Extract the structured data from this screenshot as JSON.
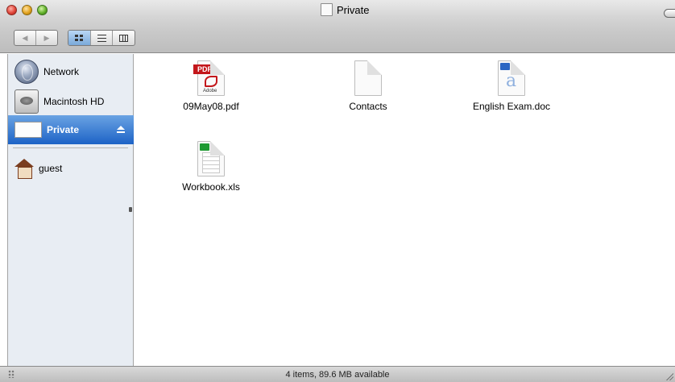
{
  "window": {
    "title": "Private",
    "drive_icon": "drive-icon"
  },
  "toolbar": {
    "back_icon": "back-arrow-icon",
    "forward_icon": "forward-arrow-icon",
    "views": [
      {
        "name": "icon-view",
        "icon": "grid-icon",
        "active": true
      },
      {
        "name": "list-view",
        "icon": "list-icon",
        "active": false
      },
      {
        "name": "column-view",
        "icon": "columns-icon",
        "active": false
      }
    ]
  },
  "sidebar": {
    "items": [
      {
        "label": "Network",
        "icon": "network-globe-icon"
      },
      {
        "label": "Macintosh HD",
        "icon": "hard-drive-icon"
      },
      {
        "label": "Private",
        "icon": "disk-image-icon",
        "selected": true,
        "eject": true
      },
      {
        "label": "guest",
        "icon": "home-icon"
      }
    ]
  },
  "files": [
    {
      "name": "09May08.pdf",
      "icon": "pdf-icon",
      "badge": "PDF",
      "brand": "Adobe"
    },
    {
      "name": "Contacts",
      "icon": "generic-document-icon"
    },
    {
      "name": "English Exam.doc",
      "icon": "word-document-icon"
    },
    {
      "name": "Workbook.xls",
      "icon": "excel-spreadsheet-icon"
    }
  ],
  "status": {
    "text": "4 items, 89.6 MB available"
  },
  "colors": {
    "selection": "#1d63c6",
    "sidebar_bg": "#e8edf3",
    "pdf_red": "#c3171b",
    "word_blue": "#2b66c3",
    "excel_green": "#1f9a33"
  }
}
